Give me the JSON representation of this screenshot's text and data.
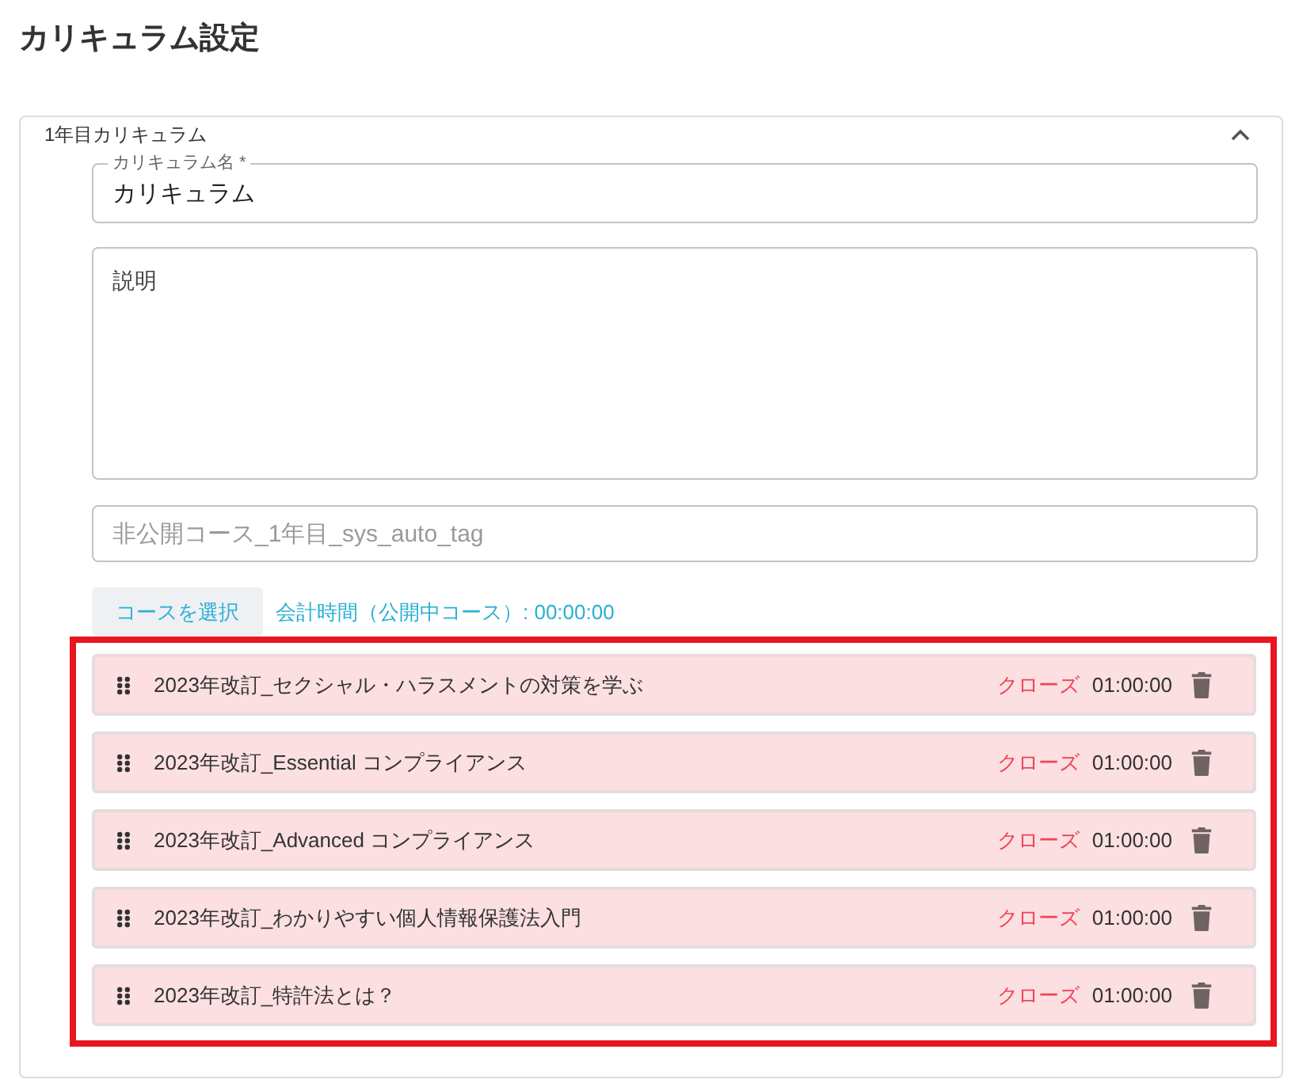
{
  "page": {
    "title": "カリキュラム設定"
  },
  "curriculum": {
    "title": "1年目カリキュラム",
    "expanded": true,
    "name_field": {
      "label": "カリキュラム名 *",
      "value": "カリキュラム"
    },
    "description_field": {
      "placeholder": "説明"
    },
    "tag_field": {
      "placeholder": "非公開コース_1年目_sys_auto_tag"
    },
    "select_course_button": "コースを選択",
    "total_time": "会計時間（公開中コース）: 00:00:00",
    "courses_highlighted": true,
    "courses": [
      {
        "title": "2023年改訂_セクシャル・ハラスメントの対策を学ぶ",
        "status": "クローズ",
        "closed": true,
        "duration": "01:00:00"
      },
      {
        "title": "2023年改訂_Essential コンプライアンス",
        "status": "クローズ",
        "closed": true,
        "duration": "01:00:00"
      },
      {
        "title": "2023年改訂_Advanced コンプライアンス",
        "status": "クローズ",
        "closed": true,
        "duration": "01:00:00"
      },
      {
        "title": "2023年改訂_わかりやすい個人情報保護法入門",
        "status": "クローズ",
        "closed": true,
        "duration": "01:00:00"
      },
      {
        "title": "2023年改訂_特許法とは？",
        "status": "クローズ",
        "closed": true,
        "duration": "01:00:00"
      }
    ]
  }
}
